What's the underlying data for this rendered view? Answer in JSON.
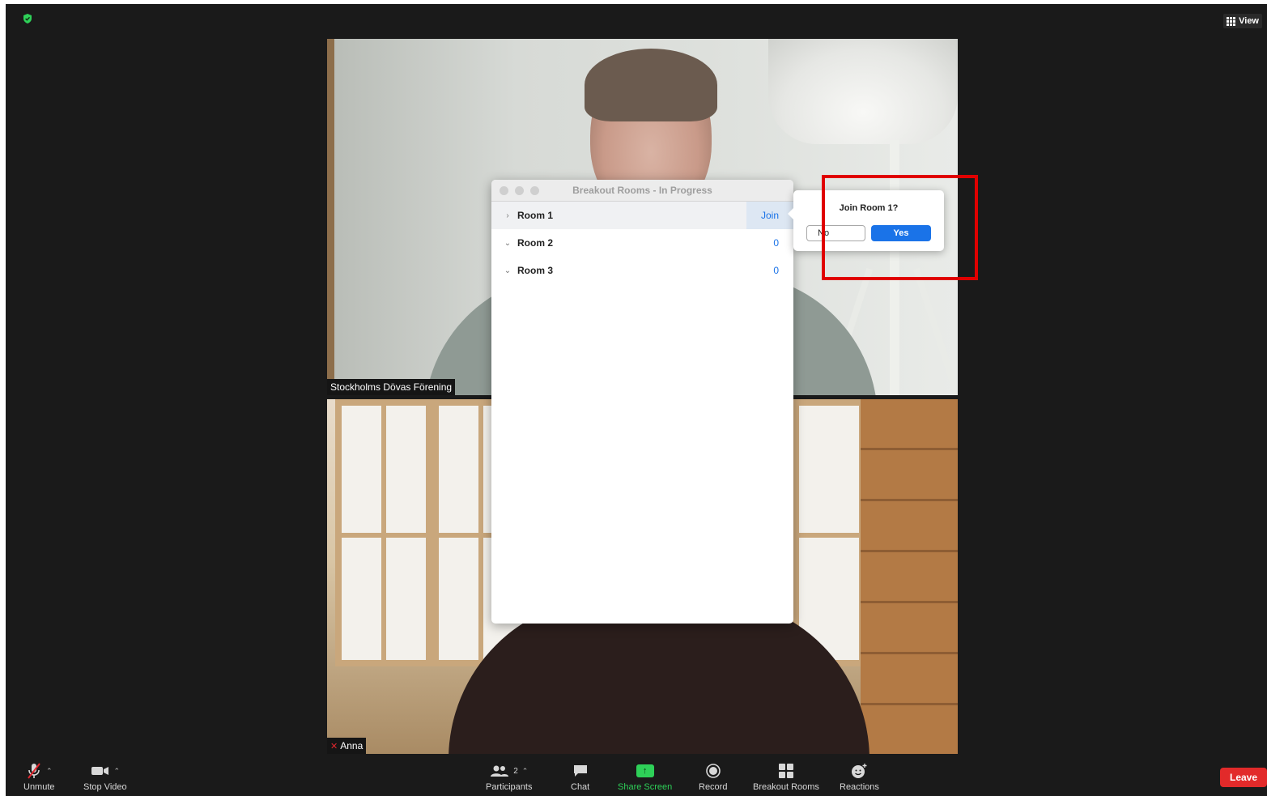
{
  "top": {
    "view_label": "View"
  },
  "tiles": [
    {
      "name": "Stockholms Dövas Förening"
    },
    {
      "name": "Anna"
    }
  ],
  "breakout_panel": {
    "title": "Breakout Rooms - In Progress",
    "rooms": [
      {
        "name": "Room 1",
        "action": "Join",
        "expanded": true
      },
      {
        "name": "Room 2",
        "count": "0",
        "expanded": false
      },
      {
        "name": "Room 3",
        "count": "0",
        "expanded": false
      }
    ]
  },
  "join_prompt": {
    "title": "Join Room 1?",
    "no_label": "No",
    "yes_label": "Yes"
  },
  "toolbar": {
    "unmute": "Unmute",
    "stop_video": "Stop Video",
    "participants": "Participants",
    "participants_count": "2",
    "chat": "Chat",
    "share_screen": "Share Screen",
    "record": "Record",
    "breakout_rooms": "Breakout Rooms",
    "reactions": "Reactions",
    "leave": "Leave"
  },
  "colors": {
    "accent_blue": "#1a73e8",
    "share_green": "#2ed058",
    "leave_red": "#e22a2a",
    "highlight_red": "#e00000"
  }
}
